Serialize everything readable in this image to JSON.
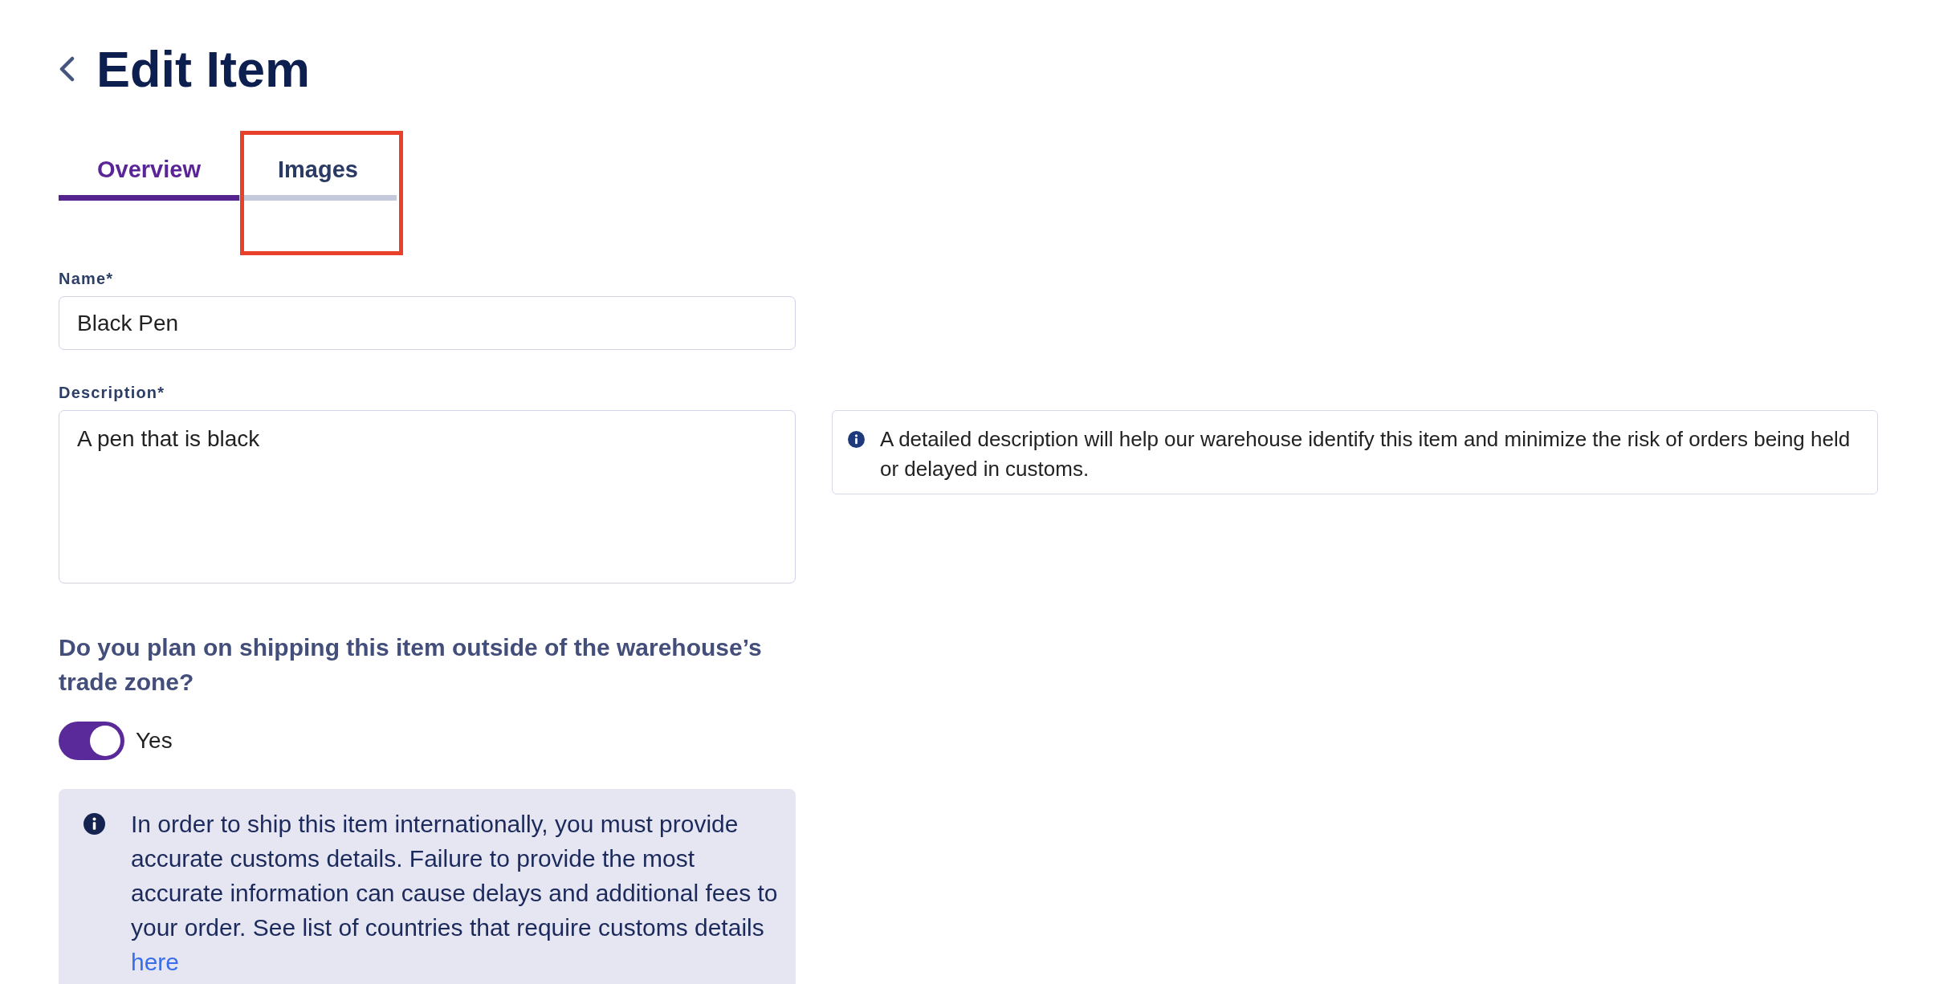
{
  "header": {
    "title": "Edit Item"
  },
  "tabs": [
    {
      "label": "Overview",
      "selected": true,
      "highlighted": false
    },
    {
      "label": "Images",
      "selected": false,
      "highlighted": true
    }
  ],
  "form": {
    "name": {
      "label": "Name*",
      "value": "Black Pen"
    },
    "description": {
      "label": "Description*",
      "value": "A pen that is black",
      "hint": "A detailed description will help our warehouse identify this item and minimize the risk of orders being held or delayed in customs."
    }
  },
  "shipping": {
    "question": "Do you plan on shipping this item outside of the warehouse’s trade zone?",
    "toggle": {
      "on": true,
      "label": "Yes"
    },
    "notice": {
      "text": "In order to ship this item internationally, you must provide accurate customs details. Failure to provide the most accurate information can cause delays and additional fees to your order. See list of countries that require customs details",
      "link": "here"
    }
  }
}
